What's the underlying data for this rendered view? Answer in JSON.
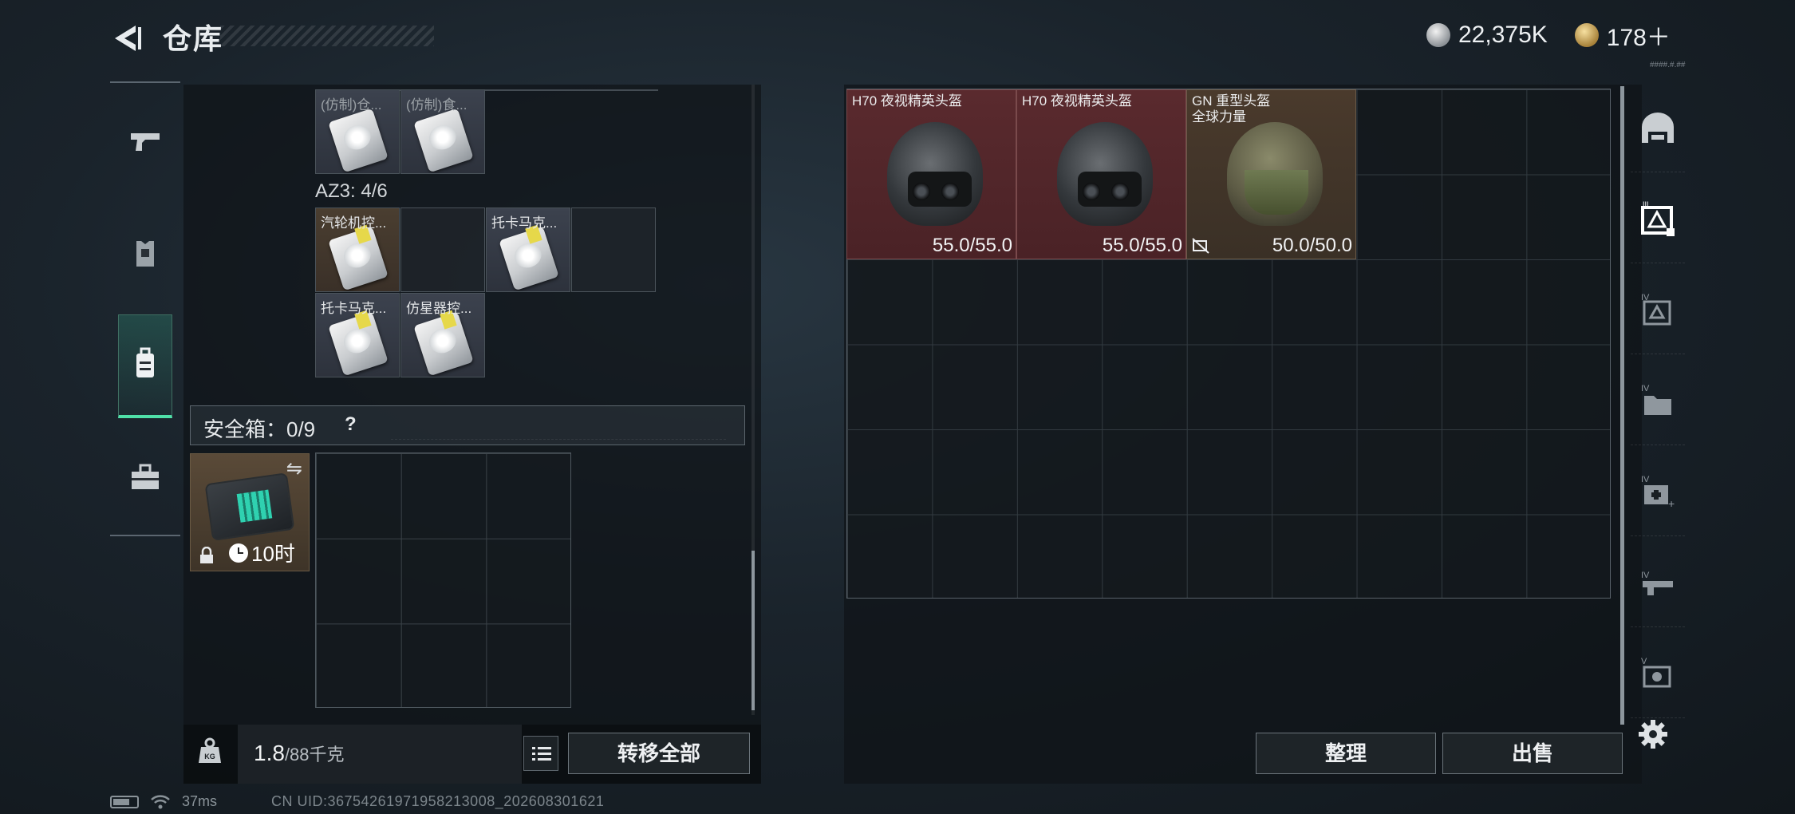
{
  "header": {
    "title": "仓库",
    "currency_silver": "22,375K",
    "currency_gold": "178＋",
    "tiny_text": "####.#.##"
  },
  "left_nav": {
    "items": [
      "pistol-icon",
      "armor-icon",
      "backpack-icon",
      "toolbox-icon"
    ],
    "active": "backpack-icon"
  },
  "left_panel": {
    "top_items": [
      {
        "label": "(仿制)仓...",
        "color": "gray"
      },
      {
        "label": "(仿制)食...",
        "color": "gray"
      }
    ],
    "az3": {
      "label": "AZ3: 4/6"
    },
    "az3_items": [
      {
        "label": "汽轮机控...",
        "color": "brown"
      },
      {
        "label": "",
        "color": "empty"
      },
      {
        "label": "托卡马克...",
        "color": "gray"
      },
      {
        "label": "",
        "color": "empty"
      },
      {
        "label": "托卡马克...",
        "color": "gray"
      },
      {
        "label": "仿星器控...",
        "color": "gray"
      }
    ],
    "safe_box": {
      "label": "安全箱：0/9",
      "help": "?",
      "timer": "10时"
    },
    "weight": "1.8",
    "weight_max": "/88千克",
    "transfer_all": "转移全部"
  },
  "right_panel": {
    "items": [
      {
        "label": "H70 夜视精英头盔",
        "durability": "55.0/55.0",
        "color": "red"
      },
      {
        "label": "H70 夜视精英头盔",
        "durability": "55.0/55.0",
        "color": "red"
      },
      {
        "label": "GN 重型头盔\n全球力量",
        "line1": "GN 重型头盔",
        "line2": "全球力量",
        "durability": "50.0/50.0",
        "color": "olive"
      }
    ],
    "sort_button": "整理",
    "sell_button": "出售"
  },
  "right_nav": {
    "items": [
      "helmet-tab-icon",
      "tier-all-icon",
      "tier4-armor-icon",
      "tier4-folder-icon",
      "tier4-medkit-icon",
      "tier4-weapon-icon",
      "tier5-item-icon"
    ]
  },
  "status_bar": {
    "ping": "37ms",
    "uid": "CN UID:36754261971958213008_202608301621"
  },
  "colors": {
    "accent_green": "#4fe0a8",
    "item_red": "#5a2a2e",
    "item_brown": "#4a3e30"
  }
}
